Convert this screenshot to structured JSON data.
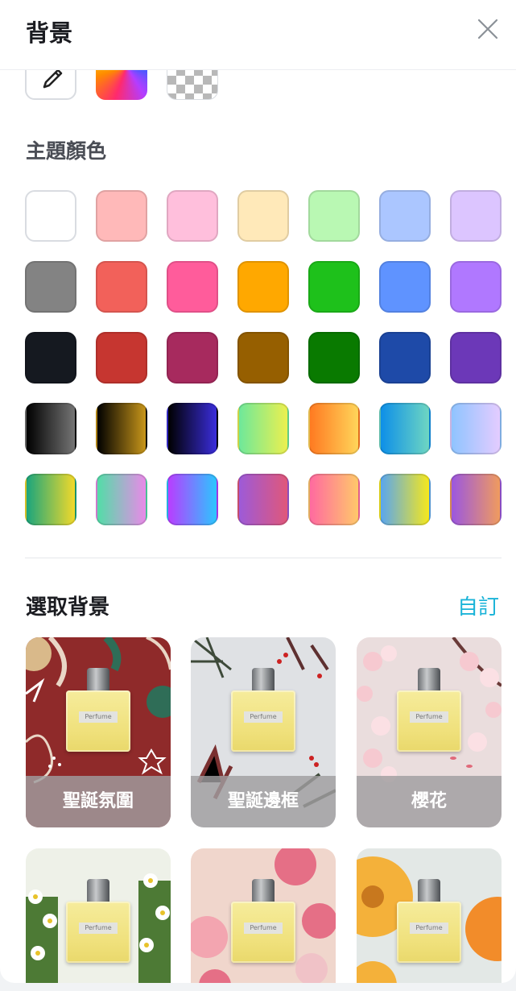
{
  "header": {
    "title": "背景",
    "close_icon": "close-icon"
  },
  "tools": [
    {
      "name": "eyedropper-tool",
      "icon": "eyedropper-icon"
    },
    {
      "name": "spectrum-picker",
      "icon": "rainbow-gradient"
    },
    {
      "name": "transparent-option",
      "icon": "checkerboard"
    }
  ],
  "theme_colors": {
    "title": "主題顏色",
    "rows": [
      [
        "#ffffff",
        "#ffb9b9",
        "#ffbfdc",
        "#ffe9b9",
        "#b9f8b3",
        "#abc6ff",
        "#dcc5ff"
      ],
      [
        "#838383",
        "#f2615a",
        "#ff5c9b",
        "#ffa800",
        "#1ec11b",
        "#5f93ff",
        "#b078ff"
      ],
      [
        "#151920",
        "#c63630",
        "#a72a5e",
        "#965f00",
        "#097a00",
        "#1e4aa8",
        "#6c38b8"
      ],
      [
        "linear-gradient(90deg,#000,#757575)",
        "linear-gradient(90deg,#000,#c8961a)",
        "linear-gradient(90deg,#000,#3a2ddb)",
        "linear-gradient(90deg,#6ee89a,#ecf04f)",
        "linear-gradient(90deg,#ff7a21,#ffd55a)",
        "linear-gradient(90deg,#0d8fe8,#6ed6c2)",
        "linear-gradient(90deg,#8fc4ff,#e4ccff)"
      ],
      [
        "linear-gradient(90deg,#1aa57d,#f2d92a)",
        "linear-gradient(90deg,#52dda7,#e98ae8)",
        "linear-gradient(90deg,#b93dff,#2bc6ff)",
        "linear-gradient(90deg,#9d5ad8,#e0577a)",
        "linear-gradient(90deg,#ff6aa0,#ffc86a)",
        "linear-gradient(90deg,#59a6ef,#f6e81c)",
        "linear-gradient(90deg,#9b57e0,#f09b5e)"
      ]
    ]
  },
  "backgrounds": {
    "title": "選取背景",
    "custom_label": "自訂",
    "bottle_text": "Perfume",
    "cards": [
      {
        "label": "聖誕氛圍",
        "bg": "#8f2a2a"
      },
      {
        "label": "聖誕邊框",
        "bg": "#dfe1e4"
      },
      {
        "label": "櫻花",
        "bg": "#eadddd"
      },
      {
        "label": "",
        "bg": "#eef1e8"
      },
      {
        "label": "",
        "bg": "#f0d6cc"
      },
      {
        "label": "",
        "bg": "#f4c77a"
      }
    ]
  }
}
